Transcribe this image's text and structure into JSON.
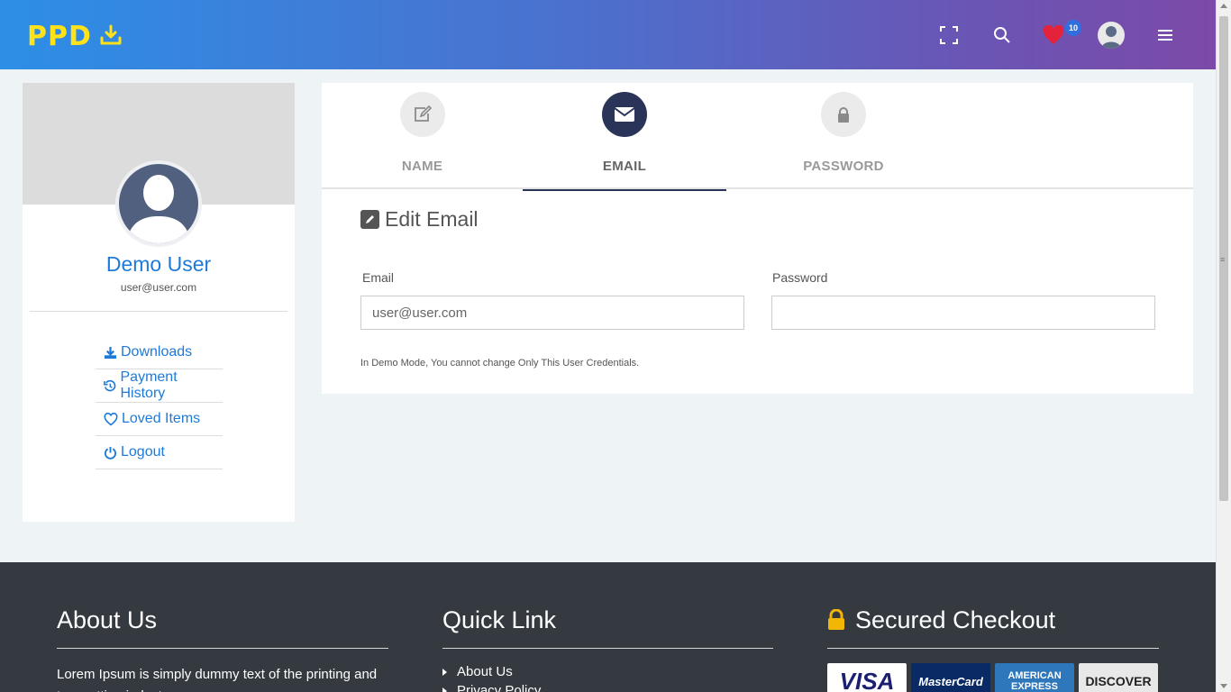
{
  "header": {
    "logo_text": "PPD",
    "icons": [
      "fullscreen-icon",
      "search-icon",
      "heart-icon",
      "avatar",
      "menu-icon"
    ],
    "loved_count": "10",
    "accent_color": "#ffe21a"
  },
  "profile": {
    "name": "Demo User",
    "email": "user@user.com",
    "menu": [
      {
        "label": "Downloads",
        "icon": "download-icon"
      },
      {
        "label": "Payment History",
        "icon": "history-icon"
      },
      {
        "label": "Loved Items",
        "icon": "heart-outline-icon"
      },
      {
        "label": "Logout",
        "icon": "power-icon"
      }
    ]
  },
  "tabs": [
    {
      "label": "NAME",
      "icon": "edit-icon",
      "active": false
    },
    {
      "label": "EMAIL",
      "icon": "envelope-icon",
      "active": true
    },
    {
      "label": "PASSWORD",
      "icon": "lock-icon",
      "active": false
    }
  ],
  "form": {
    "title": "Edit Email",
    "email_label": "Email",
    "email_value": "user@user.com",
    "password_label": "Password",
    "password_value": "",
    "note": "In Demo Mode, You cannot change Only This User Credentials."
  },
  "footer": {
    "about": {
      "title": "About Us",
      "text": "Lorem Ipsum is simply dummy text of the printing and typesetting industry."
    },
    "quick_link": {
      "title": "Quick Link",
      "links": [
        "About Us",
        "Privacy Policy"
      ]
    },
    "checkout": {
      "title": "Secured Checkout",
      "cards": [
        "VISA",
        "MasterCard",
        "AMERICAN EXPRESS",
        "DISCOVER"
      ]
    }
  },
  "colors": {
    "primary_link": "#1d7ad8",
    "active_tab": "#2a3358",
    "footer_bg": "#343a40"
  }
}
